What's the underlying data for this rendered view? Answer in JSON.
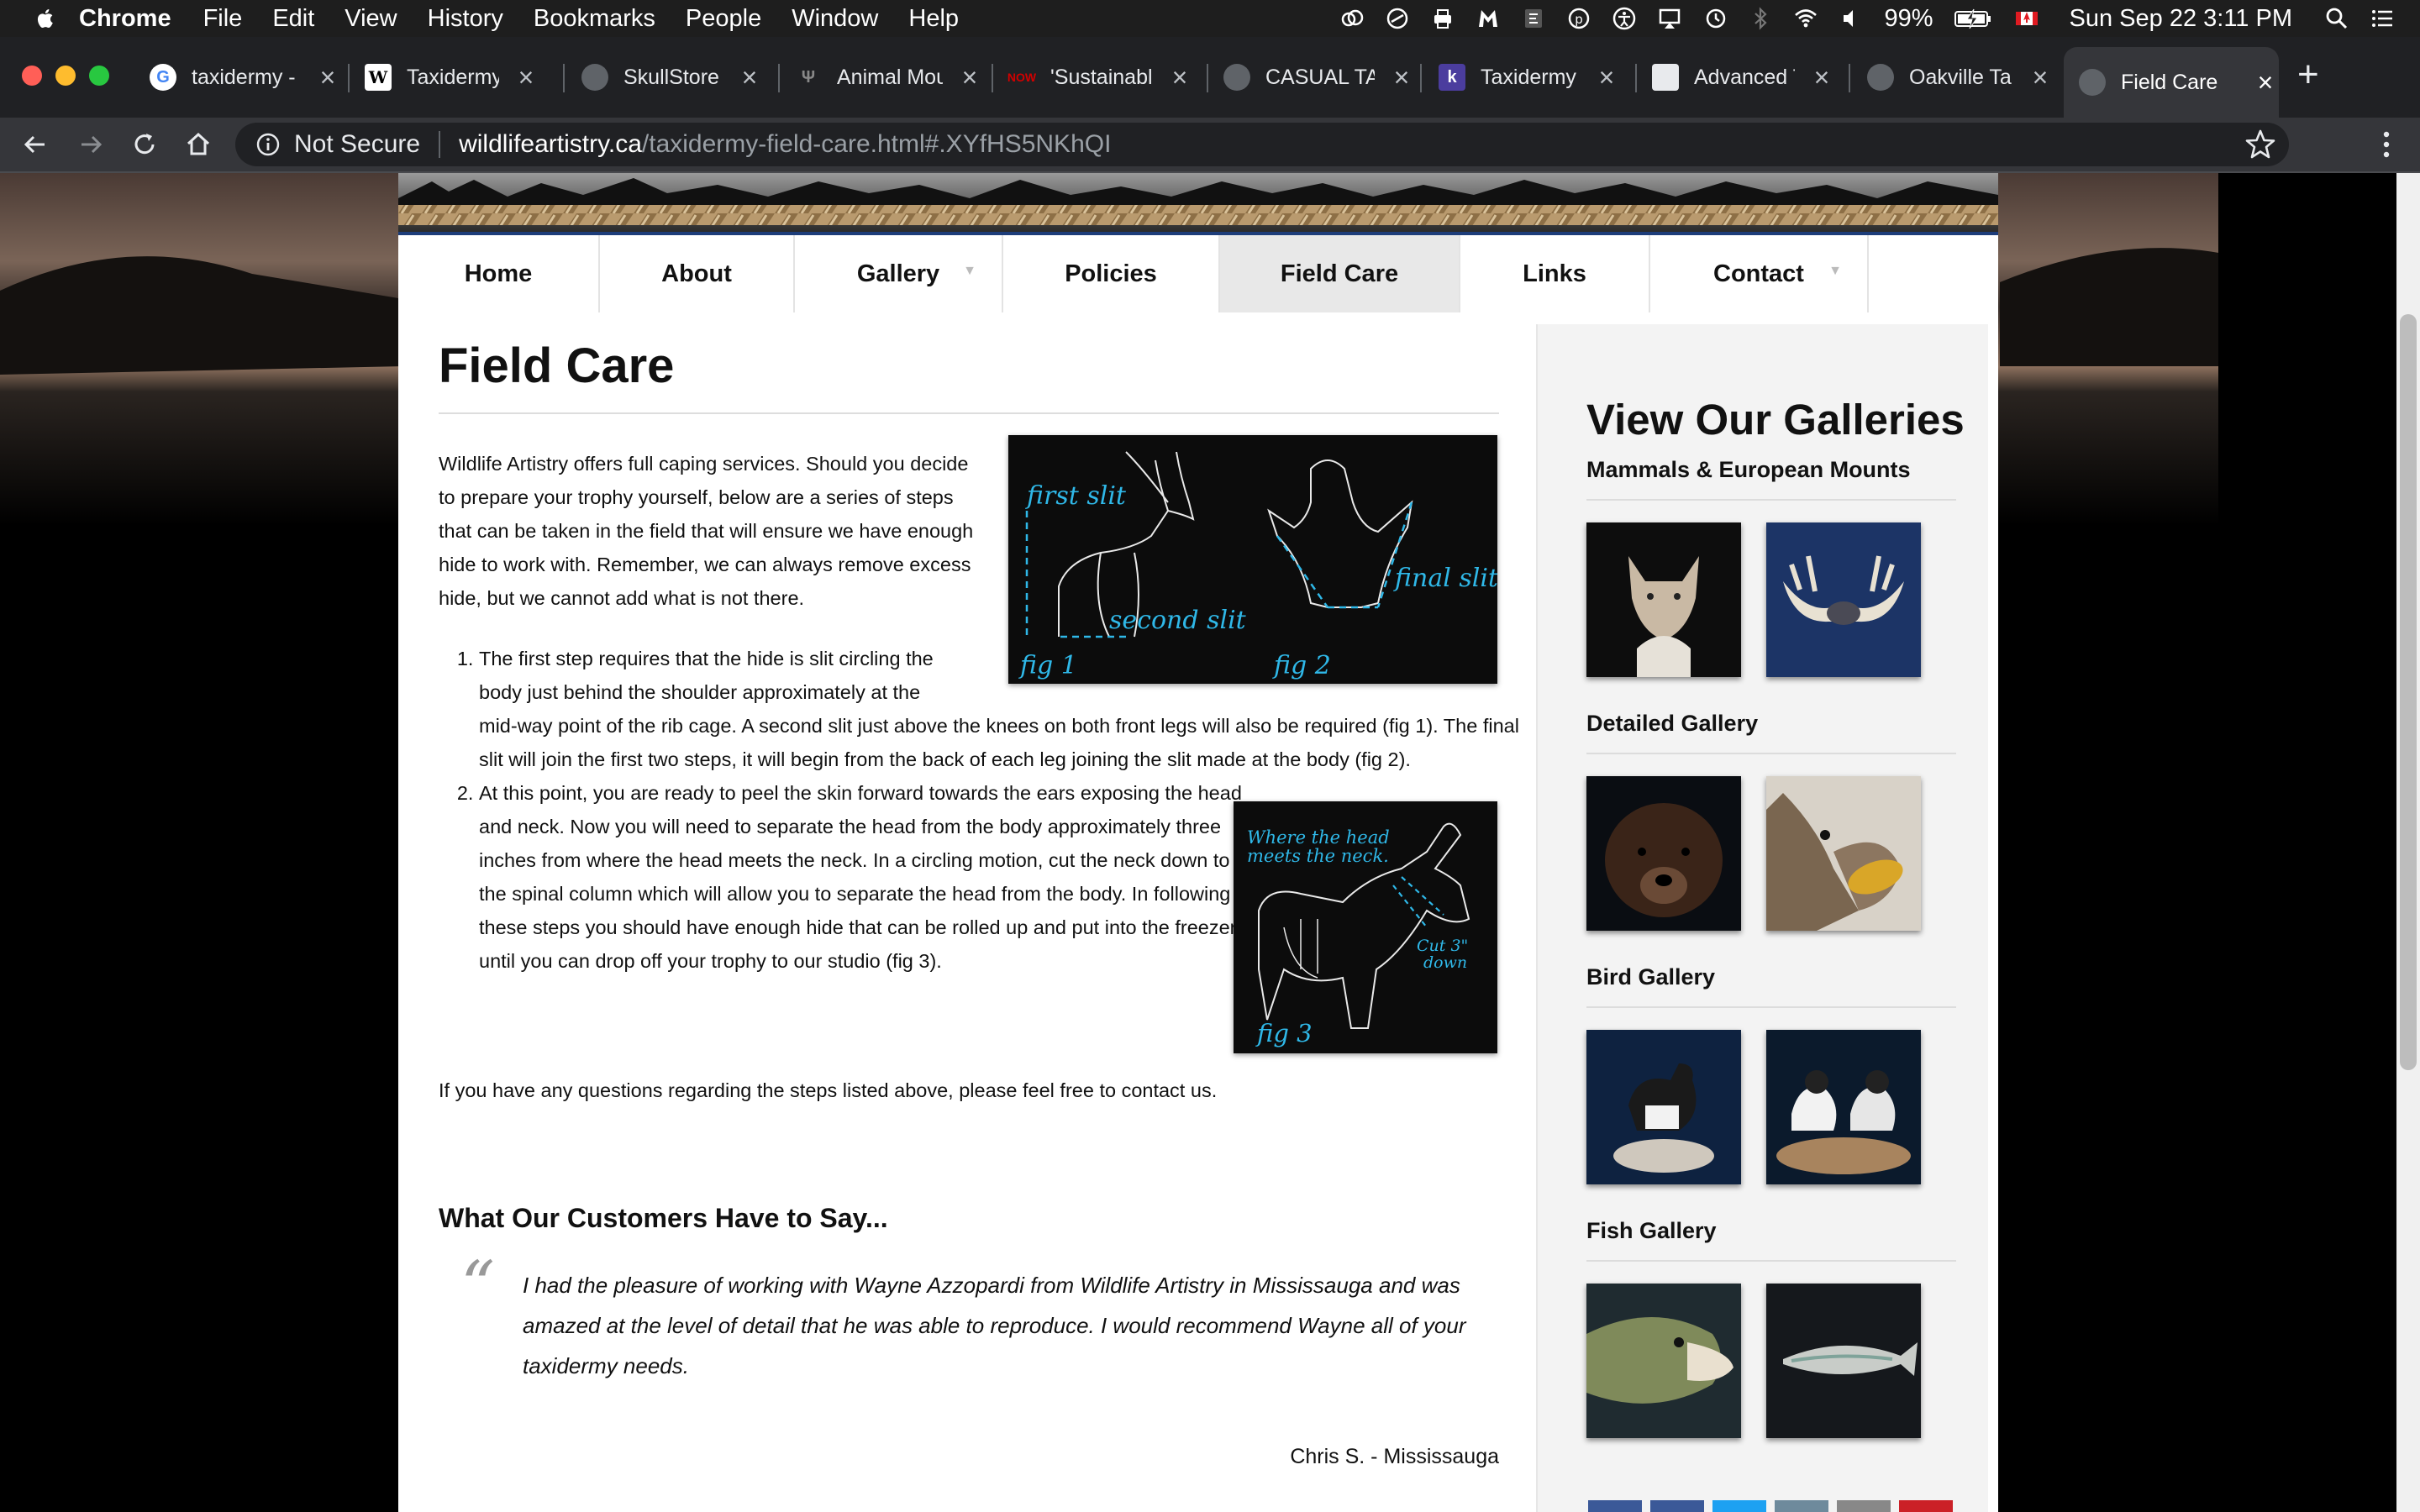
{
  "menubar": {
    "app_name": "Chrome",
    "items": [
      "File",
      "Edit",
      "View",
      "History",
      "Bookmarks",
      "People",
      "Window",
      "Help"
    ],
    "battery": "99%",
    "datetime": "Sun Sep 22  3:11 PM"
  },
  "tabs": [
    {
      "title": "taxidermy -",
      "icon": "google-icon",
      "color": "#ffffff"
    },
    {
      "title": "Taxidermy -",
      "icon": "wikipedia-icon",
      "color": "#ffffff"
    },
    {
      "title": "SkullStore |",
      "icon": "globe-icon",
      "color": "#5f6368"
    },
    {
      "title": "Animal Mou",
      "icon": "antler-icon",
      "color": "#202124"
    },
    {
      "title": "'Sustainabl",
      "icon": "now-icon",
      "color": "#d10000"
    },
    {
      "title": "CASUAL TA",
      "icon": "globe-icon",
      "color": "#5f6368"
    },
    {
      "title": "Taxidermy -",
      "icon": "k-icon",
      "color": "#4b3d9e"
    },
    {
      "title": "Advanced T",
      "icon": "image-icon",
      "color": "#e8eaed"
    },
    {
      "title": "Oakville Ta",
      "icon": "globe-icon",
      "color": "#5f6368"
    },
    {
      "title": "Field Care",
      "icon": "globe-icon",
      "color": "#5f6368"
    }
  ],
  "address": {
    "security": "Not Secure",
    "domain": "wildlifeartistry.ca",
    "path": "/taxidermy-field-care.html#.XYfHS5NKhQI"
  },
  "nav": {
    "items": [
      "Home",
      "About",
      "Gallery",
      "Policies",
      "Field Care",
      "Links",
      "Contact"
    ],
    "active": "Field Care"
  },
  "content": {
    "title": "Field Care",
    "intro": "Wildlife Artistry offers full caping services. Should you decide to prepare your trophy yourself, below are a series of steps that can be taken in the field that will ensure we have enough hide to work with. Remember, we can always remove excess hide, but we cannot add what is not there.",
    "step1": "The first step requires that the hide is slit circling the body just behind the shoulder approximately at the mid-way point of the rib cage. A second slit just above the knees on both front legs will also be required (fig 1). The final slit will join the first two steps, it will begin from the back of each leg joining the slit made at the body (fig 2).",
    "step2": "At this point, you are ready to peel the skin forward towards the ears exposing the head and neck. Now you will need to separate the head from the body approximately three inches from where the head meets the neck. In a circling motion, cut the neck down to the spinal column which will allow you to separate the head from the body. In following these steps you should have enough hide that can be rolled up and put into the freezer until you can drop off your trophy to our studio (fig 3).",
    "closing": "If you have any questions regarding the steps listed above, please feel free to contact us.",
    "fig12": {
      "first_slit": "first slit",
      "second_slit": "second slit",
      "final_slit": "final slit",
      "fig1": "fig 1",
      "fig2": "fig 2"
    },
    "fig3": {
      "head_label_1": "Where the head",
      "head_label_2": "meets the neck.",
      "cut_1": "Cut 3\"",
      "cut_2": "down",
      "fig3": "fig 3"
    },
    "testimonial_heading": "What Our Customers Have to Say...",
    "testimonial": "I had the pleasure of working with Wayne Azzopardi from Wildlife Artistry in Mississauga and was amazed at the level of detail that he was able to reproduce.  I would recommend Wayne all of your taxidermy needs.",
    "testimonial_author": "Chris S. - Mississauga"
  },
  "sidebar": {
    "title": "View Our Galleries",
    "sections": [
      {
        "name": "Mammals & European Mounts"
      },
      {
        "name": "Detailed Gallery"
      },
      {
        "name": "Bird Gallery"
      },
      {
        "name": "Fish Gallery"
      }
    ]
  },
  "colors": {
    "figure_annotation": "#2fb8e8",
    "nav_border": "#1d3d7a",
    "chrome_dark": "#202124",
    "social": [
      "#3b5998",
      "#3b5998",
      "#1da1f2",
      "#6e8a9c",
      "#888888",
      "#cb2027"
    ]
  }
}
